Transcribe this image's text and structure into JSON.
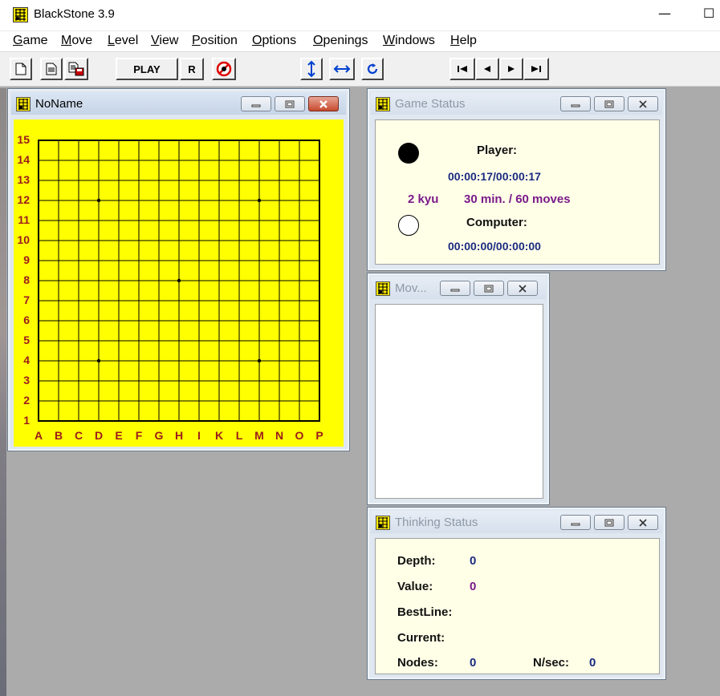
{
  "app": {
    "title": "BlackStone 3.9",
    "minimize_glyph": "—",
    "maximize_glyph": "☐"
  },
  "menu": [
    "Game",
    "Move",
    "Level",
    "View",
    "Position",
    "Options",
    "Openings",
    "Windows",
    "Help"
  ],
  "toolbar": {
    "play_label": "PLAY",
    "resign_label": "R",
    "icons": [
      "new-document-icon",
      "open-document-icon",
      "save-document-icon",
      "hint-icon",
      "flip-vertical-icon",
      "flip-horizontal-icon",
      "rotate-icon",
      "first-move-icon",
      "previous-move-icon",
      "next-move-icon",
      "last-move-icon"
    ]
  },
  "board_window": {
    "title": "NoName",
    "rows": [
      "15",
      "14",
      "13",
      "12",
      "11",
      "10",
      "9",
      "8",
      "7",
      "6",
      "5",
      "4",
      "3",
      "2",
      "1"
    ],
    "columns": [
      "A",
      "B",
      "C",
      "D",
      "E",
      "F",
      "G",
      "H",
      "I",
      "K",
      "L",
      "M",
      "N",
      "O",
      "P"
    ],
    "star_points": [
      "D12",
      "M12",
      "H8",
      "D4",
      "M4"
    ],
    "board_color": "#ffff00",
    "label_color": "#9b1b1b"
  },
  "game_status": {
    "title": "Game Status",
    "player_label": "Player:",
    "player_time": "00:00:17/00:00:17",
    "level": "2 kyu",
    "time_control": "30 min. / 60 moves",
    "computer_label": "Computer:",
    "computer_time": "00:00:00/00:00:00"
  },
  "moves_window": {
    "title": "Mov..."
  },
  "thinking_status": {
    "title": "Thinking Status",
    "depth_label": "Depth:",
    "depth_value": "0",
    "value_label": "Value:",
    "value_value": "0",
    "bestline_label": "BestLine:",
    "current_label": "Current:",
    "nodes_label": "Nodes:",
    "nodes_value": "0",
    "nsec_label": "N/sec:",
    "nsec_value": "0"
  }
}
